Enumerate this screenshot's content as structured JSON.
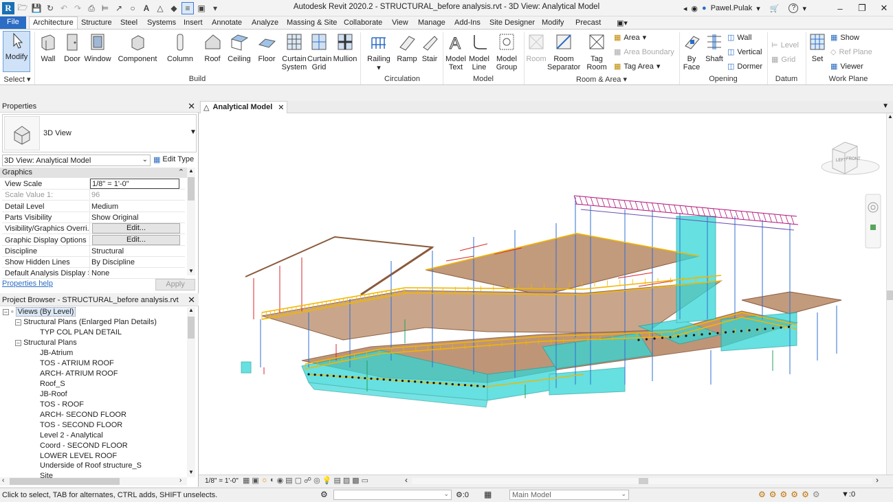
{
  "app": {
    "title": "Autodesk Revit 2020.2 - STRUCTURAL_before analysis.rvt - 3D View: Analytical Model",
    "user": "Pawel.Pulak",
    "logo_letter": "R"
  },
  "tabs": [
    "File",
    "Architecture",
    "Structure",
    "Steel",
    "Systems",
    "Insert",
    "Annotate",
    "Analyze",
    "Massing & Site",
    "Collaborate",
    "View",
    "Manage",
    "Add-Ins",
    "Site Designer",
    "Modify",
    "Precast"
  ],
  "ribbon": {
    "select": {
      "modify": "Modify",
      "label": "Select"
    },
    "build": {
      "label": "Build",
      "wall": "Wall",
      "door": "Door",
      "window": "Window",
      "component": "Component",
      "column": "Column",
      "roof": "Roof",
      "ceiling": "Ceiling",
      "floor": "Floor",
      "curtain_system": "Curtain System",
      "curtain_grid": "Curtain Grid",
      "mullion": "Mullion"
    },
    "circulation": {
      "label": "Circulation",
      "railing": "Railing",
      "ramp": "Ramp",
      "stair": "Stair"
    },
    "model": {
      "label": "Model",
      "model_text": "Model Text",
      "model_line": "Model Line",
      "model_group": "Model Group"
    },
    "room_area": {
      "label": "Room & Area",
      "room": "Room",
      "room_separator": "Room Separator",
      "tag_room": "Tag Room",
      "area": "Area",
      "area_boundary": "Area  Boundary",
      "tag_area": "Tag  Area"
    },
    "opening": {
      "label": "Opening",
      "by_face": "By Face",
      "shaft": "Shaft",
      "wall": "Wall",
      "vertical": "Vertical",
      "dormer": "Dormer"
    },
    "datum": {
      "label": "Datum",
      "level": "Level",
      "grid": "Grid"
    },
    "work_plane": {
      "label": "Work Plane",
      "set": "Set",
      "show": "Show",
      "ref_plane": "Ref  Plane",
      "viewer": "Viewer"
    }
  },
  "properties": {
    "title": "Properties",
    "type_name": "3D View",
    "instance": "3D View: Analytical Model",
    "edit_type": "Edit Type",
    "group": "Graphics",
    "rows": [
      {
        "key": "View Scale",
        "value": "1/8\" = 1'-0\""
      },
      {
        "key": "Scale Value    1:",
        "value": "96"
      },
      {
        "key": "Detail Level",
        "value": "Medium"
      },
      {
        "key": "Parts Visibility",
        "value": "Show Original"
      },
      {
        "key": "Visibility/Graphics Overri...",
        "value": "Edit..."
      },
      {
        "key": "Graphic Display Options",
        "value": "Edit..."
      },
      {
        "key": "Discipline",
        "value": "Structural"
      },
      {
        "key": "Show Hidden Lines",
        "value": "By Discipline"
      },
      {
        "key": "Default Analysis Display S...",
        "value": "None"
      }
    ],
    "help": "Properties help",
    "apply": "Apply"
  },
  "browser": {
    "title": "Project Browser - STRUCTURAL_before analysis.rvt",
    "root": "Views (By Level)",
    "group1": "Structural Plans (Enlarged Plan Details)",
    "group1_items": [
      "TYP COL PLAN DETAIL"
    ],
    "group2": "Structural Plans",
    "group2_items": [
      "JB-Atrium",
      "TOS - ATRIUM ROOF",
      "ARCH- ATRIUM ROOF",
      "Roof_S",
      "JB-Roof",
      "TOS - ROOF",
      "ARCH- SECOND FLOOR",
      "TOS - SECOND FLOOR",
      "Level 2 - Analytical",
      "Coord - SECOND FLOOR",
      "LOWER LEVEL ROOF",
      "Underside of Roof structure_S",
      "Site"
    ]
  },
  "view": {
    "tab": "Analytical Model",
    "scale": "1/8\" = 1'-0\"",
    "viewcube_left": "LEFT",
    "viewcube_front": "FRONT"
  },
  "status": {
    "hint": "Click to select, TAB for alternates, CTRL adds, SHIFT unselects.",
    "zero1": ":0",
    "model": "Main Model",
    "zero2": ":0"
  },
  "colors": {
    "accent": "#2b6cc4",
    "slab": "#b98a6a",
    "foundation": "#33d6d6",
    "railing": "#f2b600",
    "columns": "#2d6fd6",
    "roof_truss": "#b0127a"
  }
}
